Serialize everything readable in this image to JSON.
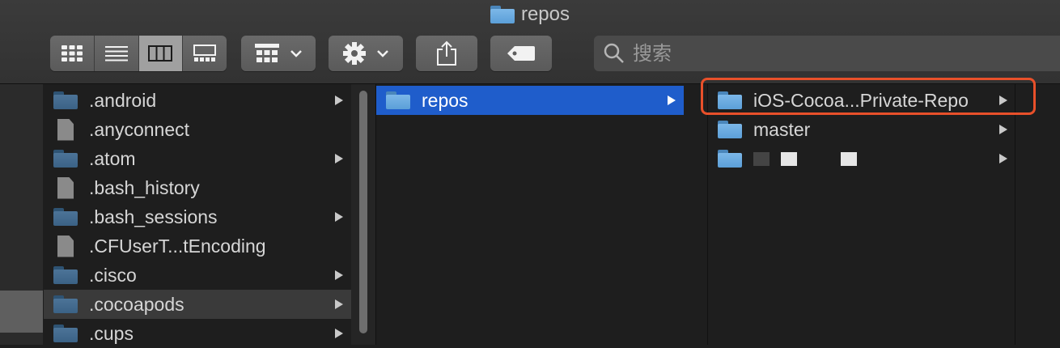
{
  "window": {
    "title": "repos"
  },
  "toolbar": {
    "view_buttons": [
      "icon-view",
      "list-view",
      "column-view",
      "gallery-view"
    ],
    "active_view": "column-view",
    "group_button": "group-by",
    "action_button": "action-gear",
    "share_button": "share",
    "tag_button": "tag",
    "search_placeholder": "搜索"
  },
  "columns": {
    "col1": [
      {
        "name": ".android",
        "type": "folder",
        "has_children": true
      },
      {
        "name": ".anyconnect",
        "type": "file",
        "has_children": false
      },
      {
        "name": ".atom",
        "type": "folder",
        "has_children": true
      },
      {
        "name": ".bash_history",
        "type": "file",
        "has_children": false
      },
      {
        "name": ".bash_sessions",
        "type": "folder",
        "has_children": true
      },
      {
        "name": ".CFUserT...tEncoding",
        "type": "file",
        "has_children": false
      },
      {
        "name": ".cisco",
        "type": "folder",
        "has_children": true
      },
      {
        "name": ".cocoapods",
        "type": "folder",
        "has_children": true,
        "state": "highlighted"
      },
      {
        "name": ".cups",
        "type": "folder",
        "has_children": true
      }
    ],
    "col2": [
      {
        "name": "repos",
        "type": "folder",
        "has_children": true,
        "state": "selected"
      }
    ],
    "col3": [
      {
        "name": "iOS-Cocoa...Private-Repo",
        "type": "folder",
        "has_children": true,
        "annotated": true
      },
      {
        "name": "master",
        "type": "folder",
        "has_children": true
      },
      {
        "name": "",
        "type": "folder",
        "has_children": true,
        "redacted": true
      }
    ]
  },
  "colors": {
    "selection": "#1f5dcb",
    "annotation": "#e8502a",
    "folder": "#5b9fd8"
  }
}
